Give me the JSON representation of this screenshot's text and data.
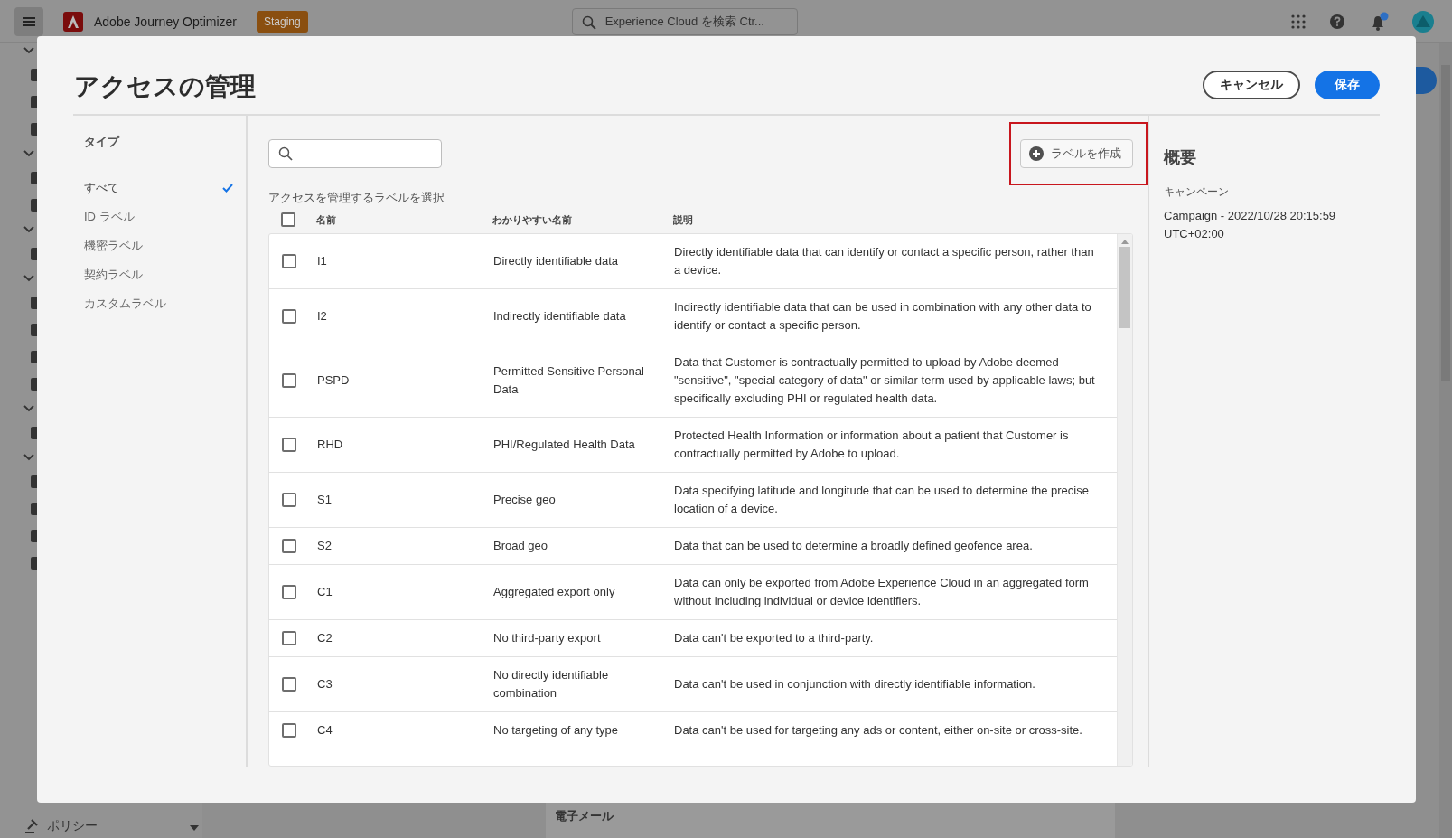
{
  "topbar": {
    "app_name": "Adobe Journey Optimizer",
    "environment_badge": "Staging",
    "search": {
      "placeholder": "Experience Cloud を検索 Ctr..."
    },
    "notifications_dot": true
  },
  "background": {
    "sidebar_item": "ポリシー",
    "section_title": "電子メール"
  },
  "modal": {
    "title": "アクセスの管理",
    "buttons": [
      {
        "label": "キャンセル",
        "kind": "secondary"
      },
      {
        "label": "保存",
        "kind": "primary"
      }
    ],
    "filter": {
      "heading": "タイプ",
      "items": [
        {
          "label": "すべて",
          "selected": true
        },
        {
          "label": "ID ラベル",
          "selected": false
        },
        {
          "label": "機密ラベル",
          "selected": false
        },
        {
          "label": "契約ラベル",
          "selected": false
        },
        {
          "label": "カスタムラベル",
          "selected": false
        }
      ]
    },
    "create_label_button": {
      "label": "ラベルを作成",
      "highlighted": true
    },
    "instruction": "アクセスを管理するラベルを選択",
    "table": {
      "select_all_checked": false,
      "columns": [
        "名前",
        "わかりやすい名前",
        "説明"
      ],
      "rows": [
        {
          "name": "I1",
          "friendly_name": "Directly identifiable data",
          "description": "Directly identifiable data that can identify or contact a specific person, rather than a device.",
          "checked": false
        },
        {
          "name": "I2",
          "friendly_name": "Indirectly identifiable data",
          "description": "Indirectly identifiable data that can be used in combination with any other data to identify or contact a specific person.",
          "checked": false
        },
        {
          "name": "PSPD",
          "friendly_name": "Permitted Sensitive Personal Data",
          "description": "Data that Customer is contractually permitted to upload by Adobe deemed \"sensitive\", \"special category of data\" or similar term used by applicable laws; but specifically excluding PHI or regulated health data.",
          "checked": false
        },
        {
          "name": "RHD",
          "friendly_name": "PHI/Regulated Health Data",
          "description": "Protected Health Information or information about a patient that Customer is contractually permitted by Adobe to upload.",
          "checked": false
        },
        {
          "name": "S1",
          "friendly_name": "Precise geo",
          "description": "Data specifying latitude and longitude that can be used to determine the precise location of a device.",
          "checked": false
        },
        {
          "name": "S2",
          "friendly_name": "Broad geo",
          "description": "Data that can be used to determine a broadly defined geofence area.",
          "checked": false
        },
        {
          "name": "C1",
          "friendly_name": "Aggregated export only",
          "description": "Data can only be exported from Adobe Experience Cloud in an aggregated form without including individual or device identifiers.",
          "checked": false
        },
        {
          "name": "C2",
          "friendly_name": "No third-party export",
          "description": "Data can't be exported to a third-party.",
          "checked": false
        },
        {
          "name": "C3",
          "friendly_name": "No directly identifiable combination",
          "description": "Data can't be used in conjunction with directly identifiable information.",
          "checked": false
        },
        {
          "name": "C4",
          "friendly_name": "No targeting of any type",
          "description": "Data can't be used for targeting any ads or content, either on-site or cross-site.",
          "checked": false
        }
      ]
    },
    "summary": {
      "heading": "概要",
      "field_label": "キャンペーン",
      "field_value": "Campaign - 2022/10/28 20:15:59 UTC+02:00"
    }
  }
}
